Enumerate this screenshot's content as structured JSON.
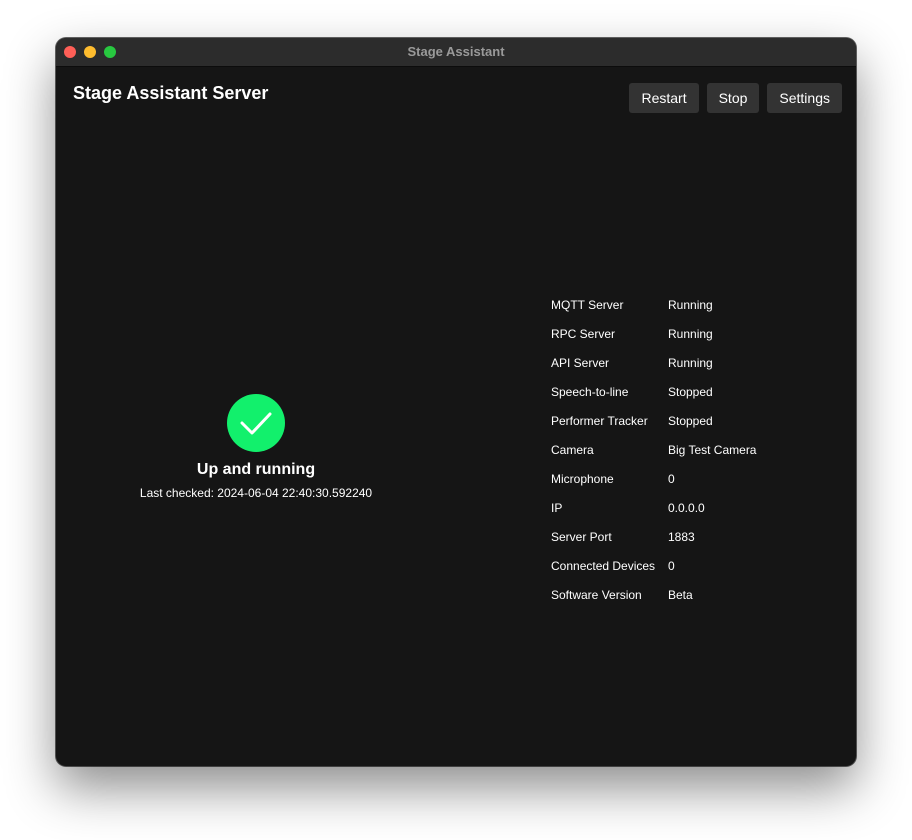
{
  "window": {
    "title": "Stage Assistant"
  },
  "header": {
    "title": "Stage Assistant Server"
  },
  "toolbar": {
    "restart_label": "Restart",
    "stop_label": "Stop",
    "settings_label": "Settings"
  },
  "status": {
    "icon": "checkmark-icon",
    "color": "#12f06c",
    "text": "Up and running",
    "last_checked": "Last checked: 2024-06-04 22:40:30.592240"
  },
  "info": [
    {
      "label": "MQTT Server",
      "value": "Running"
    },
    {
      "label": "RPC Server",
      "value": "Running"
    },
    {
      "label": "API Server",
      "value": "Running"
    },
    {
      "label": "Speech-to-line",
      "value": "Stopped"
    },
    {
      "label": "Performer Tracker",
      "value": "Stopped"
    },
    {
      "label": "Camera",
      "value": "Big Test Camera"
    },
    {
      "label": "Microphone",
      "value": "0"
    },
    {
      "label": "IP",
      "value": "0.0.0.0"
    },
    {
      "label": "Server Port",
      "value": "1883"
    },
    {
      "label": "Connected Devices",
      "value": "0"
    },
    {
      "label": "Software Version",
      "value": "Beta"
    }
  ]
}
